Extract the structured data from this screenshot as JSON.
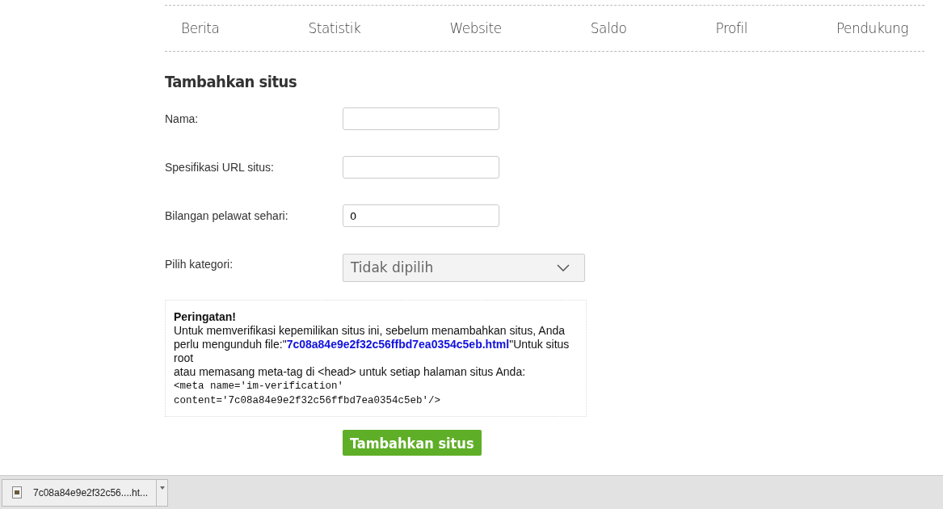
{
  "nav": [
    {
      "label": "Berita"
    },
    {
      "label": "Statistik"
    },
    {
      "label": "Website"
    },
    {
      "label": "Saldo"
    },
    {
      "label": "Profil"
    },
    {
      "label": "Pendukung"
    }
  ],
  "heading": "Tambahkan situs",
  "fields": [
    {
      "kind": "input",
      "label": "Nama:"
    },
    {
      "kind": "input",
      "label": "Spesifikasi URL situs:"
    },
    {
      "kind": "input",
      "label": "Bilangan pelawat sehari:",
      "value": "0"
    },
    {
      "kind": "select",
      "label": "Pilih kategori:",
      "value": "Tidak dipilih"
    }
  ],
  "warning": {
    "title": "Peringatan!",
    "text_before": "Untuk memverifikasi kepemilikan situs ini, sebelum menambahkan situs, Anda perlu mengunduh file:\"",
    "link": "7c08a84e9e2f32c56ffbd7ea0354c5eb.html",
    "text_after": "\"Untuk situs root",
    "text_2": "atau memasang meta-tag di <head> untuk setiap halaman situs Anda:",
    "code": [
      "<meta name='im-verification'",
      "content='7c08a84e9e2f32c56ffbd7ea0354c5eb'/>"
    ]
  },
  "submit": "Tambahkan situs",
  "download": {
    "filename": "7c08a84e9e2f32c56....ht..."
  }
}
